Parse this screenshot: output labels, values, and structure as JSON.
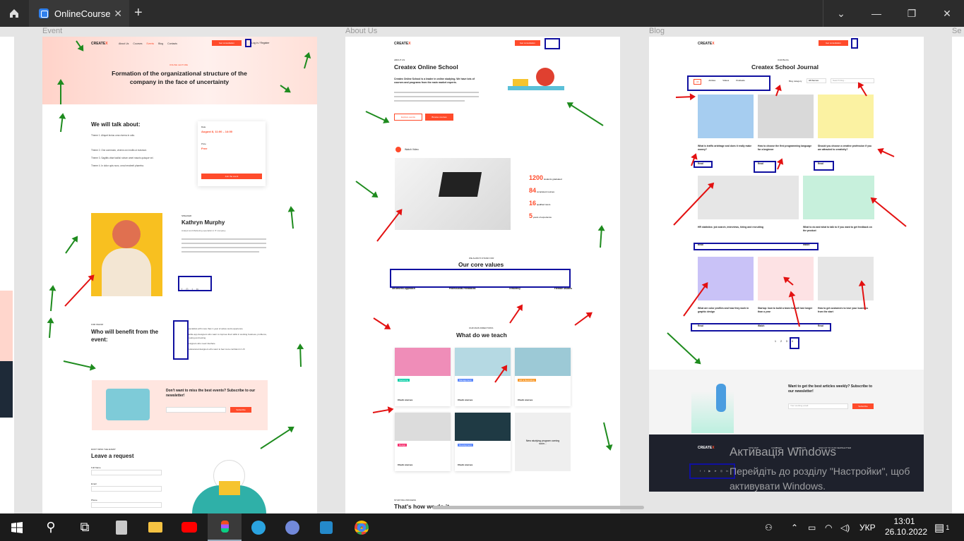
{
  "window": {
    "tab_title": "OnlineCourse",
    "close_tab": "✕",
    "new_tab": "+",
    "controls": {
      "dropdown": "⌄",
      "minimize": "—",
      "maximize": "❐",
      "close": "✕"
    }
  },
  "frames": {
    "event": {
      "label": "Event",
      "nav": {
        "logo_a": "CREATE",
        "logo_b": "X",
        "links": [
          "About Us",
          "Courses",
          "Events",
          "Blog",
          "Contacts"
        ],
        "cta": "Get consultation",
        "login": "Log in / Register"
      },
      "hero_eyebrow": "ONLINE LECTURE",
      "hero_title": "Formation of the organizational structure of the company in the face of uncertainty",
      "talk_title": "We will talk about:",
      "themes": [
        "Theme 1. Aliquet lectus urna viverra in odio.",
        "Theme 2. Orci commodo, viverra orci mollis ut euismod.",
        "Theme 3. Sagittis vitae facilisi rutrum amet mauris quisque vel.",
        "Theme 4. In dolor quis nunc, urna hendrerit pharetra."
      ],
      "date_label": "Date",
      "date_value": "August 8, 11:00 – 14:00",
      "price_label": "Price",
      "price_value": "Free",
      "join_label": "Join the event",
      "speaker_eyebrow": "SPEAKER",
      "speaker_name": "Kathryn Murphy",
      "speaker_role": "Analyst and Marketing specialist in IT company",
      "benefit_eyebrow": "FOR WHOM",
      "benefit_title": "Who will benefit from the event:",
      "benefits": [
        "Specialists with more than 1 year of active work experience",
        "Mobile app designers who want to improve their skills in working business, problems, creating and testing",
        "Designers who need interface",
        "Professional designers who want to feel more confident in UX"
      ],
      "newsletter_title": "Don't want to miss the best events? Subscribe to our newsletter!",
      "subscribe": "Subscribe",
      "request_eyebrow": "DON'T MISS THE EVENT",
      "request_title": "Leave a request",
      "field_name": "Full Name",
      "field_email": "Email",
      "field_phone": "Phone"
    },
    "about": {
      "label": "About Us",
      "eyebrow": "ABOUT US",
      "title": "Createx Online School",
      "lead": "Createx Online School is a leader in online studying. We have lots of courses and programs from the main market experts.",
      "btn_explore": "Explore events",
      "btn_browse": "Browse courses",
      "watch": "Watch Video",
      "stats": [
        {
          "n": "1200",
          "l": "students graduated"
        },
        {
          "n": "84",
          "l": "completed courses"
        },
        {
          "n": "16",
          "l": "qualified tutors"
        },
        {
          "n": "5",
          "l": "years of experience"
        }
      ],
      "values_eyebrow": "WE ALWAYS STAND FOR",
      "values_title": "Our core values",
      "values": [
        "Structured Approach",
        "Professional Feedbacks",
        "Efficiency",
        "Flexible Studies"
      ],
      "teach_eyebrow": "OUR MAIN DIRECTIONS",
      "teach_title": "What do we teach",
      "teach": [
        {
          "tag": "Marketing",
          "color": "#03cea4",
          "link": "Check courses"
        },
        {
          "tag": "Management",
          "color": "#5a87fc",
          "link": "Check courses"
        },
        {
          "tag": "HR & Recruiting",
          "color": "#f89828",
          "link": "Check courses"
        },
        {
          "tag": "Design",
          "color": "#f52f6e",
          "link": "Check courses"
        },
        {
          "tag": "Development",
          "color": "#5a87fc",
          "link": "Check courses"
        }
      ],
      "coming": "New studying program coming soon...",
      "process_eyebrow": "STUDYING PROCESS",
      "process_title": "That's how we do it"
    },
    "blog": {
      "label": "Blog",
      "eyebrow": "OUR BLOG",
      "title": "Createx School Journal",
      "filters": [
        "All",
        "Articles",
        "Videos",
        "Podcasts"
      ],
      "category_label": "Blog category",
      "category_value": "All themes",
      "search": "Search blog...",
      "posts": [
        {
          "title": "What is traffic arbitrage and does it really make money?",
          "read": "Read"
        },
        {
          "title": "How to choose the first programming language for a beginner",
          "read": "Read"
        },
        {
          "title": "Should you choose a creative profession if you are attracted to creativity?",
          "read": "Read"
        },
        {
          "title": "HR statistics: job search, interviews, hiring and recruiting",
          "read": "Read"
        },
        {
          "title": "What to do and what to talk to if you want to get feedback on the product",
          "read": "Watch"
        },
        {
          "title": "What are color profiles and how they work in graphic design",
          "read": "Read"
        },
        {
          "title": "Startup: how to build a team that will last longer than a year",
          "read": "Watch"
        },
        {
          "title": "How to get customers to love your business from the start",
          "read": "Read"
        }
      ],
      "pages": [
        "1",
        "2",
        "3",
        "4",
        "→"
      ],
      "sub_title": "Want to get the best articles weekly? Subscribe to our newsletter!",
      "sub_btn": "Subscribe",
      "sub_placeholder": "Your working email",
      "footer": {
        "logo_a": "CREATE",
        "logo_b": "X",
        "cols": [
          "SITE MAP",
          "COURSES",
          "CONTACTS",
          "SIGN UP TO OUR NEWSLETTER"
        ]
      }
    },
    "next_label": "Se"
  },
  "watermark": {
    "title": "Активація Windows",
    "text": "Перейдіть до розділу \"Настройки\", щоб активувати Windows."
  },
  "taskbar": {
    "lang": "УКР",
    "time": "13:01",
    "date": "26.10.2022",
    "notif": "1"
  }
}
